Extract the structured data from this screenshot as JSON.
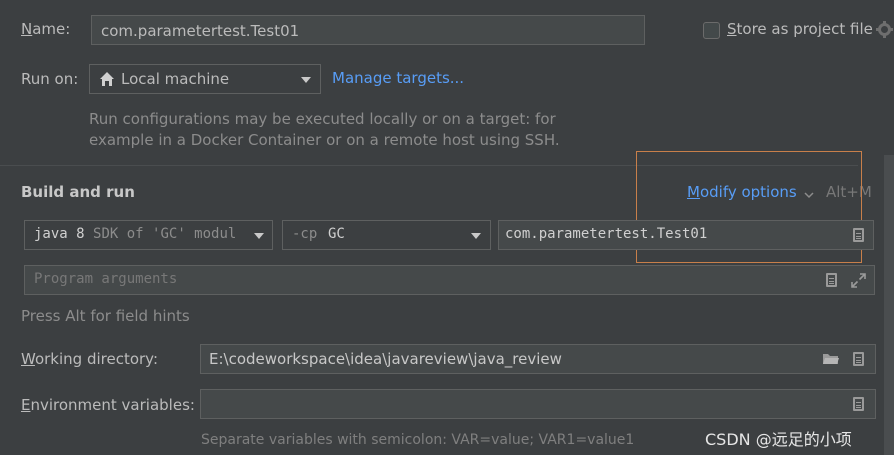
{
  "name": {
    "label_u": "N",
    "label_rest": "ame:",
    "value": "com.parametertest.Test01"
  },
  "store": {
    "label_u": "S",
    "label_rest": "tore as project file"
  },
  "run_on": {
    "label": "Run on:",
    "selected": "Local machine",
    "manage_link": "Manage targets...",
    "description_line1": "Run configurations may be executed locally or on a target: for",
    "description_line2": "example in a Docker Container or on a remote host using SSH."
  },
  "build_run": {
    "title": "Build and run",
    "modify_u": "M",
    "modify_rest": "odify options",
    "modify_shortcut": "Alt+M",
    "jdk_kw": "java",
    "jdk_ver": "8",
    "jdk_desc": "SDK of 'GC' modul",
    "cp_flag": "-cp",
    "cp_value": "GC",
    "main_class": "com.parametertest.Test01",
    "program_args_placeholder": "Program arguments",
    "hint": "Press Alt for field hints"
  },
  "working_dir": {
    "label_u": "W",
    "label_rest": "orking directory:",
    "value": "E:\\codeworkspace\\idea\\javareview\\java_review"
  },
  "env": {
    "label_u": "E",
    "label_rest": "nvironment variables:",
    "value": "",
    "hint": "Separate variables with semicolon: VAR=value; VAR1=value1"
  },
  "watermark": "CSDN @远足的小项",
  "colors": {
    "background": "#3c3f41",
    "field_bg": "#45494a",
    "link": "#589df6",
    "highlight_box": "#c87f4a"
  },
  "icons": [
    "gear-icon",
    "home-icon",
    "chevron-down-icon",
    "document-icon",
    "folder-icon",
    "expand-icon"
  ]
}
